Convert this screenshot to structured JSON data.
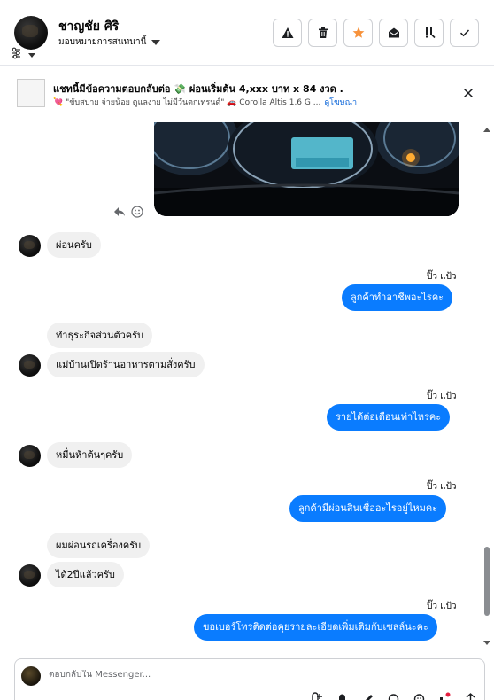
{
  "header": {
    "contact_name": "ชาญชัย ศิริ",
    "assign_label": "มอบหมายการสนทนานี้",
    "actions": [
      {
        "name": "report-button",
        "icon": "warning-icon"
      },
      {
        "name": "delete-button",
        "icon": "trash-icon"
      },
      {
        "name": "star-button",
        "icon": "star-icon",
        "color": "#f7923b"
      },
      {
        "name": "mark-unread-button",
        "icon": "envelope-open-icon"
      },
      {
        "name": "follow-up-button",
        "icon": "exclamation-icon"
      },
      {
        "name": "done-button",
        "icon": "checkmark-icon"
      }
    ]
  },
  "ad": {
    "title": "แชทนี้มีข้อความตอบกลับต่อ 💸 ผ่อนเริ่มต้น 4,xxx บาท x 84 งวด .",
    "subtitle": "💘 \"ขับสบาย จ่ายน้อย ดูแลง่าย ไม่มีวันตกเทรนด์\" 🚗 Corolla Altis 1.6 G ...",
    "link": "ดูโฆษณา"
  },
  "messages": {
    "in_1": "ผ่อนครับ",
    "out_sender_1": "ปิ๊ว แป้ว",
    "out_1": "ลูกค้าทำอาชีพอะไรคะ",
    "in_2": "ทำธุระกิจส่วนตัวครับ",
    "in_3": "แม่บ้านเปิดร้านอาหารตามสั่งครับ",
    "out_sender_2": "ปิ๊ว แป้ว",
    "out_2": "รายได้ต่อเดือนเท่าไหร่คะ",
    "in_4": "หมื่นห้าต้นๆครับ",
    "out_sender_3": "ปิ๊ว แป้ว",
    "out_3": "ลูกค้ามีผ่อนสินเชื่ออะไรอยู่ไหมคะ",
    "in_5": "ผมผ่อนรถเครื่องครับ",
    "in_6": "ได้2ปีแล้วครับ",
    "out_sender_4": "ปิ๊ว แป้ว",
    "out_4": "ขอเบอร์โทรติดต่อคุยรายละเอียดเพิ่มเติมกับเซลล์นะคะ"
  },
  "composer": {
    "placeholder": "ตอบกลับใน Messenger..."
  },
  "colors": {
    "outgoing_bubble": "#0a7cff",
    "incoming_bubble": "#f0f0f0",
    "link": "#0a64d8",
    "star": "#f7923b"
  }
}
